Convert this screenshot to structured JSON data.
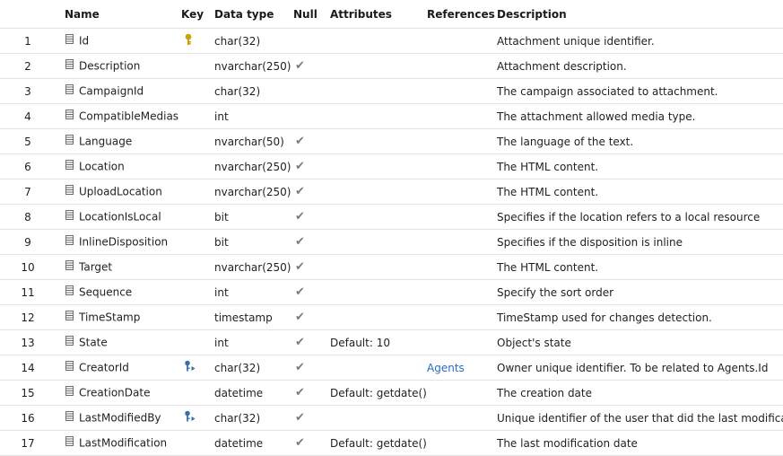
{
  "headers": {
    "name": "Name",
    "key": "Key",
    "data_type": "Data type",
    "null": "Null",
    "attributes": "Attributes",
    "references": "References",
    "description": "Description"
  },
  "icons": {
    "column": "column-icon",
    "primary_key": "key-icon",
    "foreign_key": "foreign-key-icon",
    "nullable": "checkmark-icon"
  },
  "colors": {
    "key_icon": "#c9a400",
    "foreign_key_icon": "#3a6ea5",
    "link": "#2b6cc4",
    "checkmark": "#7a7a7a",
    "row_border": "#e4e4e4"
  },
  "rows": [
    {
      "num": "1",
      "name": "Id",
      "key": "pk",
      "type": "char(32)",
      "null": false,
      "attributes": "",
      "references": "",
      "description": "Attachment unique identifier."
    },
    {
      "num": "2",
      "name": "Description",
      "key": "",
      "type": "nvarchar(250)",
      "null": true,
      "attributes": "",
      "references": "",
      "description": "Attachment description."
    },
    {
      "num": "3",
      "name": "CampaignId",
      "key": "",
      "type": "char(32)",
      "null": false,
      "attributes": "",
      "references": "",
      "description": "The campaign associated to attachment."
    },
    {
      "num": "4",
      "name": "CompatibleMedias",
      "key": "",
      "type": "int",
      "null": false,
      "attributes": "",
      "references": "",
      "description": "The attachment allowed media type."
    },
    {
      "num": "5",
      "name": "Language",
      "key": "",
      "type": "nvarchar(50)",
      "null": true,
      "attributes": "",
      "references": "",
      "description": "The language of the text."
    },
    {
      "num": "6",
      "name": "Location",
      "key": "",
      "type": "nvarchar(250)",
      "null": true,
      "attributes": "",
      "references": "",
      "description": "The HTML content."
    },
    {
      "num": "7",
      "name": "UploadLocation",
      "key": "",
      "type": "nvarchar(250)",
      "null": true,
      "attributes": "",
      "references": "",
      "description": "The HTML content."
    },
    {
      "num": "8",
      "name": "LocationIsLocal",
      "key": "",
      "type": "bit",
      "null": true,
      "attributes": "",
      "references": "",
      "description": "Specifies if the location refers to a local resource"
    },
    {
      "num": "9",
      "name": "InlineDisposition",
      "key": "",
      "type": "bit",
      "null": true,
      "attributes": "",
      "references": "",
      "description": "Specifies if the disposition is inline"
    },
    {
      "num": "10",
      "name": "Target",
      "key": "",
      "type": "nvarchar(250)",
      "null": true,
      "attributes": "",
      "references": "",
      "description": "The HTML content."
    },
    {
      "num": "11",
      "name": "Sequence",
      "key": "",
      "type": "int",
      "null": true,
      "attributes": "",
      "references": "",
      "description": "Specify the sort order"
    },
    {
      "num": "12",
      "name": "TimeStamp",
      "key": "",
      "type": "timestamp",
      "null": true,
      "attributes": "",
      "references": "",
      "description": "TimeStamp used for changes detection."
    },
    {
      "num": "13",
      "name": "State",
      "key": "",
      "type": "int",
      "null": true,
      "attributes": "Default: 10",
      "references": "",
      "description": "Object's state"
    },
    {
      "num": "14",
      "name": "CreatorId",
      "key": "fk",
      "type": "char(32)",
      "null": true,
      "attributes": "",
      "references": "Agents",
      "description": "Owner unique identifier. To be related to Agents.Id"
    },
    {
      "num": "15",
      "name": "CreationDate",
      "key": "",
      "type": "datetime",
      "null": true,
      "attributes": "Default: getdate()",
      "references": "",
      "description": "The creation date"
    },
    {
      "num": "16",
      "name": "LastModifiedBy",
      "key": "fk",
      "type": "char(32)",
      "null": true,
      "attributes": "",
      "references": "",
      "description": "Unique identifier of the user that did the last modifications"
    },
    {
      "num": "17",
      "name": "LastModification",
      "key": "",
      "type": "datetime",
      "null": true,
      "attributes": "Default: getdate()",
      "references": "",
      "description": "The last modification date"
    }
  ]
}
